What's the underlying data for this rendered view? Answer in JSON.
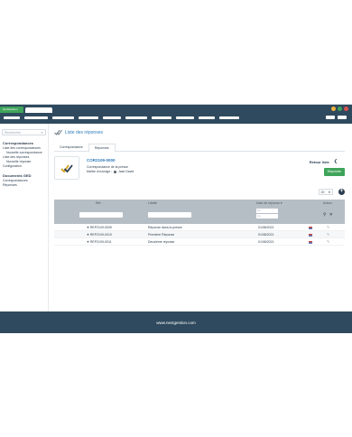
{
  "window": {
    "app_tab": "NextGestion",
    "dot_colors": [
      "#f2b43c",
      "#3fa45a",
      "#d9534f"
    ]
  },
  "sidebar": {
    "search_placeholder": "Rechercher",
    "sections": [
      {
        "title": "Correspondances",
        "items": [
          {
            "label": "Liste des correspondances",
            "sub": false
          },
          {
            "label": "Nouvelle correspondance",
            "sub": true
          },
          {
            "label": "Liste des réponses",
            "sub": false
          },
          {
            "label": "Nouvelle réponse",
            "sub": true
          },
          {
            "label": "Configuration",
            "sub": false
          }
        ]
      },
      {
        "title": "Documents GED",
        "items": [
          {
            "label": "Correspondances",
            "sub": false
          },
          {
            "label": "Réponses",
            "sub": false
          }
        ]
      }
    ]
  },
  "main": {
    "page_title": "Liste des réponses",
    "tabs": [
      {
        "label": "Correspondance",
        "active": false
      },
      {
        "label": "Réponses",
        "active": true
      }
    ],
    "card": {
      "ref": "COR2109-0000",
      "subject": "Correspondance de la presse",
      "owner_label": "Maître d'ouvrage :",
      "owner_name": "Jack David",
      "retour_label": "Retour liste",
      "reply_button": "Répondre"
    },
    "page_size": "20",
    "table": {
      "headers": {
        "ref": "Réf.",
        "label": "Libellé",
        "date": "Date de réponse",
        "action": "Action"
      },
      "date_placeholders": [
        "Du",
        "Au"
      ],
      "rows": [
        {
          "ref": "REP2109-0009",
          "label": "Réponse dans la presse",
          "date": "01/08/2021"
        },
        {
          "ref": "REP2109-0010",
          "label": "Première Réponse",
          "date": "01/08/2021"
        },
        {
          "ref": "REP2109-0011",
          "label": "Deuxième réponse",
          "date": "01/08/2021"
        }
      ]
    }
  },
  "footer": {
    "text": "www.nextgestion.com"
  },
  "colors": {
    "accent": "#3fa45a",
    "nav": "#2f4a5e",
    "link": "#2e7bb8"
  }
}
